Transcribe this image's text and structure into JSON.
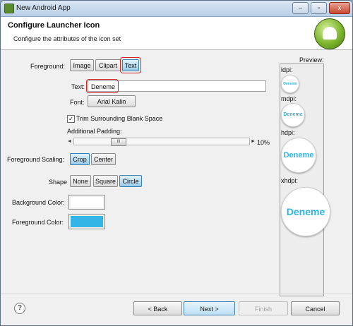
{
  "window": {
    "title": "New Android App",
    "controls": [
      "–",
      "▫",
      "x"
    ]
  },
  "header": {
    "title": "Configure Launcher Icon",
    "subtitle": "Configure the attributes of the icon set"
  },
  "foreground": {
    "label": "Foreground:",
    "options": [
      "Image",
      "Clipart",
      "Text"
    ],
    "selected": "Text"
  },
  "text": {
    "label": "Text:",
    "value": "Deneme"
  },
  "font": {
    "label": "Font:",
    "value": "Arial Kalin"
  },
  "trim": {
    "label": "Trim Surrounding Blank Space",
    "checked": true
  },
  "padding": {
    "label": "Additional Padding:",
    "value": "10%",
    "thumb": "III",
    "left_arrow": "◄",
    "right_arrow": "►",
    "level": 0.1
  },
  "scaling": {
    "label": "Foreground Scaling:",
    "options": [
      "Crop",
      "Center"
    ],
    "selected": "Crop"
  },
  "shape": {
    "label": "Shape",
    "options": [
      "None",
      "Square",
      "Circle"
    ],
    "selected": "Circle"
  },
  "background_color": {
    "label": "Background Color:",
    "color": "#ffffff"
  },
  "foreground_color": {
    "label": "Foreground Color:",
    "color": "#33b5e5"
  },
  "preview": {
    "label": "Preview:",
    "items": [
      {
        "density": "ldpi:",
        "text": "Deneme"
      },
      {
        "density": "mdpi:",
        "text": "Deneme"
      },
      {
        "density": "hdpi:",
        "text": "Deneme"
      },
      {
        "density": "xhdpi:",
        "text": "Deneme"
      }
    ]
  },
  "footer": {
    "help": "?",
    "back": "< Back",
    "next": "Next >",
    "finish": "Finish",
    "cancel": "Cancel"
  }
}
